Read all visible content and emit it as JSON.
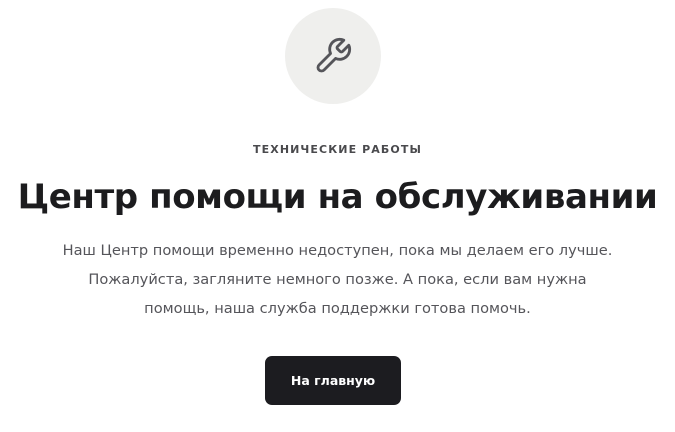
{
  "icon": {
    "name": "wrench-icon"
  },
  "eyebrow": "ТЕХНИЧЕСКИЕ РАБОТЫ",
  "title": "Центр помощи на обслуживании",
  "description": {
    "lines": [
      "Наш Центр помощи временно недоступен, пока мы делаем его лучше.",
      "Пожалуйста, загляните немного позже. А пока, если вам нужна",
      "помощь, наша служба поддержки готова помочь."
    ]
  },
  "button": {
    "label": "На главную"
  },
  "colors": {
    "icon_bg": "#efefed",
    "icon_stroke": "#55555a",
    "title": "#1c1c1e",
    "text": "#55555a",
    "button_bg": "#1c1c20",
    "button_text": "#ffffff"
  }
}
